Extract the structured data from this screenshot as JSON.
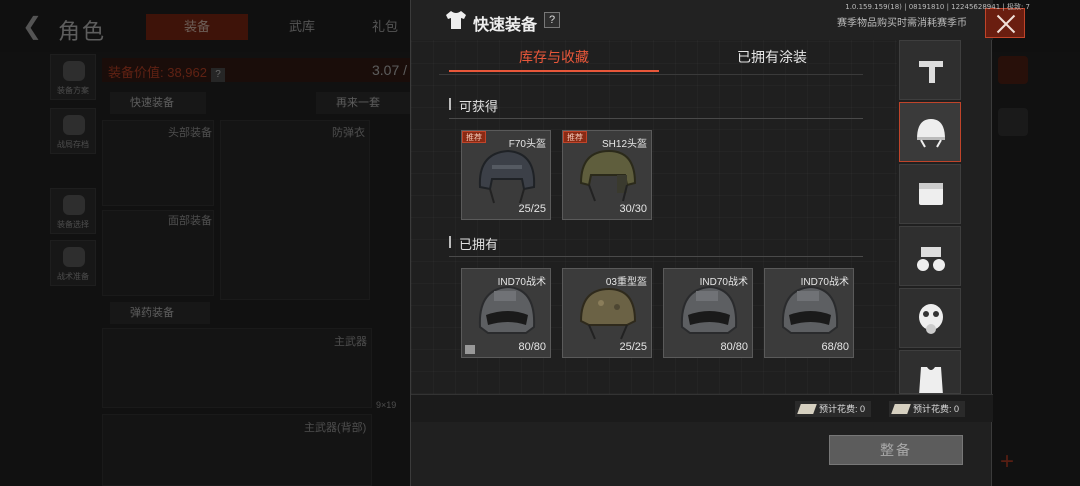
{
  "version_text": "1.0.159.159(18) | 08191810 | 12245628941 | 极致: 7",
  "background": {
    "title": "角色",
    "tabs": [
      "装备",
      "武库",
      "礼包"
    ],
    "sidebar_items": [
      "装备方案",
      "战局存档",
      "装备选择",
      "战术准备"
    ],
    "value_label": "装备价值: 38,962",
    "value_help": "?",
    "weight": "3.07 /",
    "quick_equip_label": "快速装备",
    "buy_again_label": "再来一套",
    "slots": [
      "头部装备",
      "防弹衣",
      "面部装备",
      "主武器",
      "主武器(背部)"
    ],
    "supply_label": "弹药装备",
    "ammo_caliber": "9×19"
  },
  "modal": {
    "title": "快速装备",
    "help": "?",
    "note": "赛季物品购买时需消耗赛季币",
    "tabs": [
      "库存与收藏",
      "已拥有涂装"
    ],
    "sections": {
      "obtainable": {
        "title": "可获得",
        "items": [
          {
            "name": "F70头盔",
            "qty": "25/25",
            "badge": "推荐",
            "color": "#3c4048"
          },
          {
            "name": "SH12头盔",
            "qty": "30/30",
            "badge": "推荐",
            "color": "#5f5e3d"
          }
        ]
      },
      "owned": {
        "title": "已拥有",
        "items": [
          {
            "name": "IND70战术",
            "qty": "80/80",
            "color": "#5d5f62"
          },
          {
            "name": "03重型盔",
            "qty": "25/25",
            "color": "#6b6245"
          },
          {
            "name": "IND70战术",
            "qty": "80/80",
            "color": "#5d5f62"
          },
          {
            "name": "IND70战术",
            "qty": "68/80",
            "color": "#5d5f62"
          }
        ]
      }
    },
    "categories": [
      "weapon-icon",
      "helmet-icon",
      "pouch-icon",
      "night-vision-icon",
      "gas-mask-icon",
      "armor-vest-icon"
    ],
    "cost_labels": [
      "预计花费: 0",
      "预计花费: 0"
    ],
    "equip_label": "整备",
    "accent": "#e8573a"
  }
}
